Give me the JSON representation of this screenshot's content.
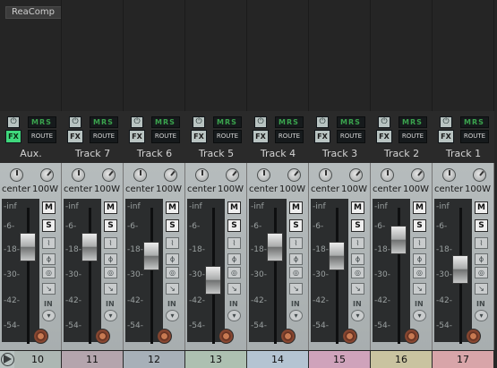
{
  "fx_slot": {
    "label": "ReaComp"
  },
  "controls": {
    "power_glyph": "⏻",
    "fx_label": "FX",
    "mrs_label": "MRS",
    "route_label": "ROUTE",
    "pan_value": "center",
    "width_value": "100W",
    "mute_label": "M",
    "solo_label": "S",
    "phase_label": "ϕ",
    "input_label": "IN"
  },
  "meter_scale": [
    "-inf",
    "-6-",
    "-18-",
    "-30-",
    "-42-",
    "-54-"
  ],
  "strips": [
    {
      "name": "Aux.",
      "number": "10",
      "fx_active": true,
      "fader_db": -17,
      "number_color": "#adb7b3"
    },
    {
      "name": "Track 7",
      "number": "11",
      "fx_active": false,
      "fader_db": -17,
      "number_color": "#b4a5ad"
    },
    {
      "name": "Track 6",
      "number": "12",
      "fx_active": false,
      "fader_db": -21,
      "number_color": "#a7b0b8"
    },
    {
      "name": "Track 5",
      "number": "13",
      "fx_active": false,
      "fader_db": -32,
      "number_color": "#adc0b1"
    },
    {
      "name": "Track 4",
      "number": "14",
      "fx_active": false,
      "fader_db": -17,
      "number_color": "#b4c4d2"
    },
    {
      "name": "Track 3",
      "number": "15",
      "fx_active": false,
      "fader_db": -21,
      "number_color": "#cfa3bb"
    },
    {
      "name": "Track 2",
      "number": "16",
      "fx_active": false,
      "fader_db": -14,
      "number_color": "#c9c3a0"
    },
    {
      "name": "Track 1",
      "number": "17",
      "fx_active": false,
      "fader_db": -27,
      "number_color": "#d8a5a9"
    }
  ]
}
